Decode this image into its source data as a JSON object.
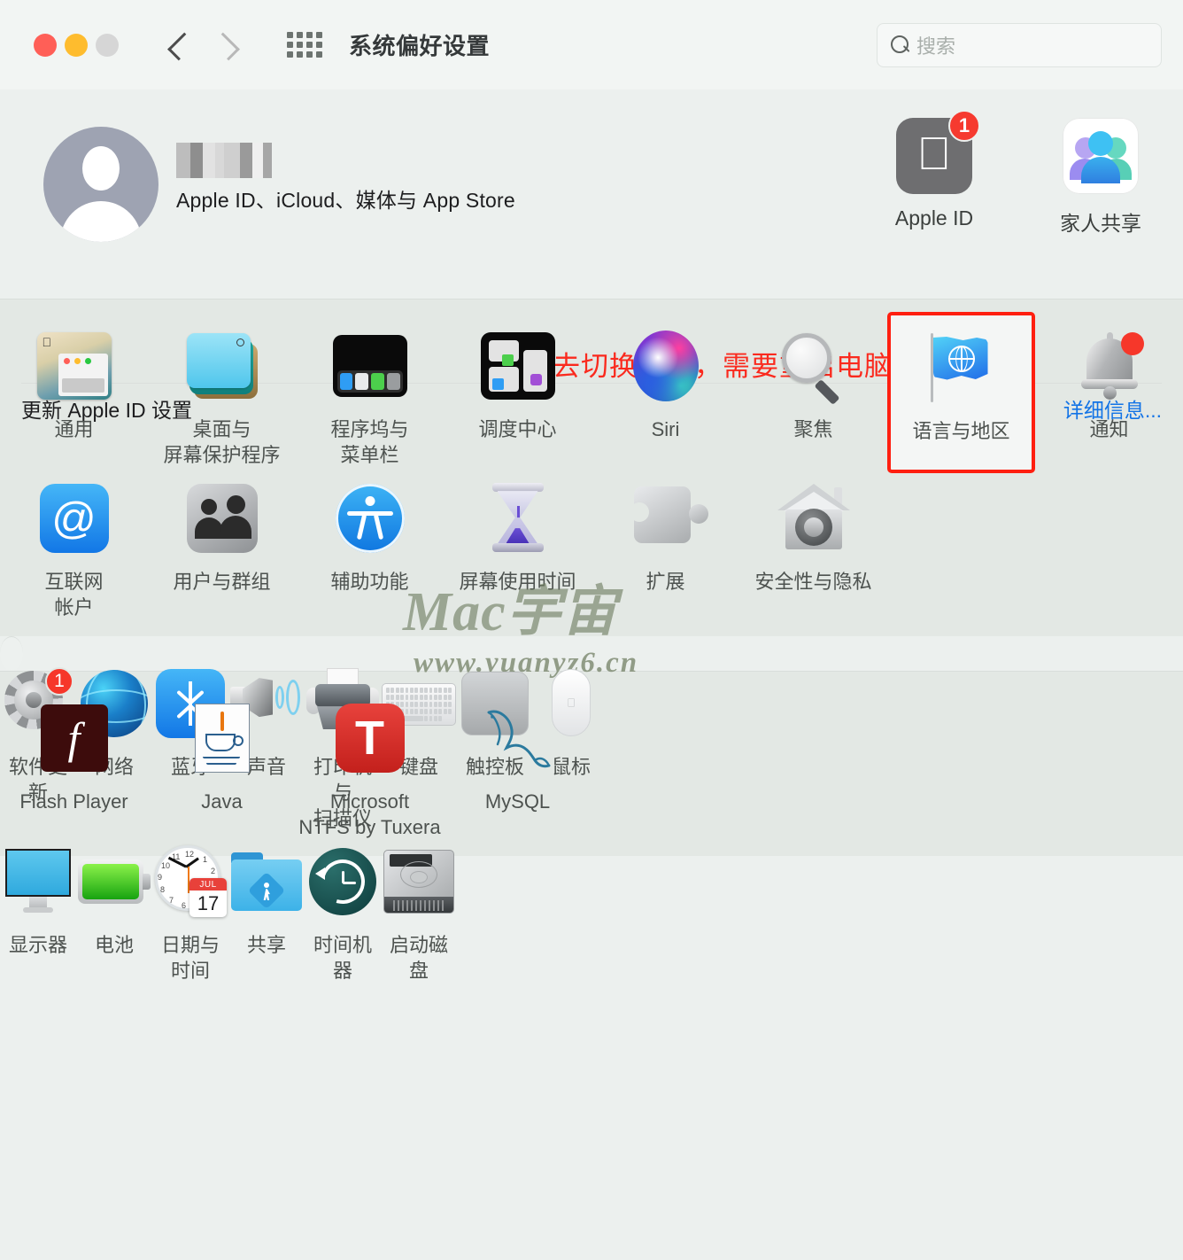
{
  "window": {
    "title": "系统偏好设置",
    "traffic_lights": [
      "close",
      "minimize",
      "zoom"
    ],
    "back_label": "后退",
    "forward_label": "前进",
    "grid_label": "显示全部"
  },
  "search": {
    "placeholder": "搜索",
    "value": ""
  },
  "apple_id_hero": {
    "account_name_redacted": "",
    "subtitle": "Apple ID、iCloud、媒体与 App Store",
    "tiles": [
      {
        "label": "Apple ID",
        "icon": "apple-logo-icon",
        "badge": "1"
      },
      {
        "label": "家人共享",
        "icon": "family-sharing-icon",
        "badge": ""
      }
    ],
    "update_text": "更新 Apple ID 设置",
    "details_link": "详细信息..."
  },
  "annotation": {
    "text": "点进去切换繁体，需要重启电脑",
    "color": "#fa2a1e"
  },
  "watermark": {
    "line1": "Mac宇宙",
    "line2": "www.yuanyz6.cn"
  },
  "highlight": {
    "target": "语言与地区",
    "color": "#ff1f10"
  },
  "groups": [
    {
      "id": "group-system",
      "items": [
        {
          "label": "通用",
          "icon": "general-icon"
        },
        {
          "label": "桌面与\n屏幕保护程序",
          "icon": "desktop-screensaver-icon"
        },
        {
          "label": "程序坞与\n菜单栏",
          "icon": "dock-menubar-icon"
        },
        {
          "label": "调度中心",
          "icon": "mission-control-icon"
        },
        {
          "label": "Siri",
          "icon": "siri-icon"
        },
        {
          "label": "聚焦",
          "icon": "spotlight-icon"
        },
        {
          "label": "语言与地区",
          "icon": "language-region-icon",
          "highlighted": true
        },
        {
          "label": "通知",
          "icon": "notifications-icon",
          "badge_dot": true
        },
        {
          "label": "互联网\n帐户",
          "icon": "internet-accounts-icon"
        },
        {
          "label": "用户与群组",
          "icon": "users-groups-icon"
        },
        {
          "label": "辅助功能",
          "icon": "accessibility-icon"
        },
        {
          "label": "屏幕使用时间",
          "icon": "screen-time-icon"
        },
        {
          "label": "扩展",
          "icon": "extensions-icon"
        },
        {
          "label": "安全性与隐私",
          "icon": "security-privacy-icon"
        }
      ]
    },
    {
      "id": "group-hardware",
      "items": [
        {
          "label": "软件更新",
          "icon": "software-update-icon",
          "badge": "1"
        },
        {
          "label": "网络",
          "icon": "network-icon"
        },
        {
          "label": "蓝牙",
          "icon": "bluetooth-icon"
        },
        {
          "label": "声音",
          "icon": "sound-icon"
        },
        {
          "label": "打印机与\n扫描仪",
          "icon": "printers-scanners-icon"
        },
        {
          "label": "键盘",
          "icon": "keyboard-icon"
        },
        {
          "label": "触控板",
          "icon": "trackpad-icon"
        },
        {
          "label": "鼠标",
          "icon": "mouse-icon"
        },
        {
          "label": "显示器",
          "icon": "displays-icon"
        },
        {
          "label": "电池",
          "icon": "battery-icon"
        },
        {
          "label": "日期与时间",
          "icon": "date-time-icon",
          "month": "JUL",
          "day": "17"
        },
        {
          "label": "共享",
          "icon": "sharing-icon"
        },
        {
          "label": "时间机器",
          "icon": "time-machine-icon"
        },
        {
          "label": "启动磁盘",
          "icon": "startup-disk-icon"
        }
      ]
    },
    {
      "id": "group-third-party",
      "items": [
        {
          "label": "Flash Player",
          "icon": "flash-player-icon"
        },
        {
          "label": "Java",
          "icon": "java-icon"
        },
        {
          "label": "Microsoft\nNTFS by Tuxera",
          "icon": "tuxera-ntfs-icon"
        },
        {
          "label": "MySQL",
          "icon": "mysql-icon"
        }
      ]
    }
  ]
}
